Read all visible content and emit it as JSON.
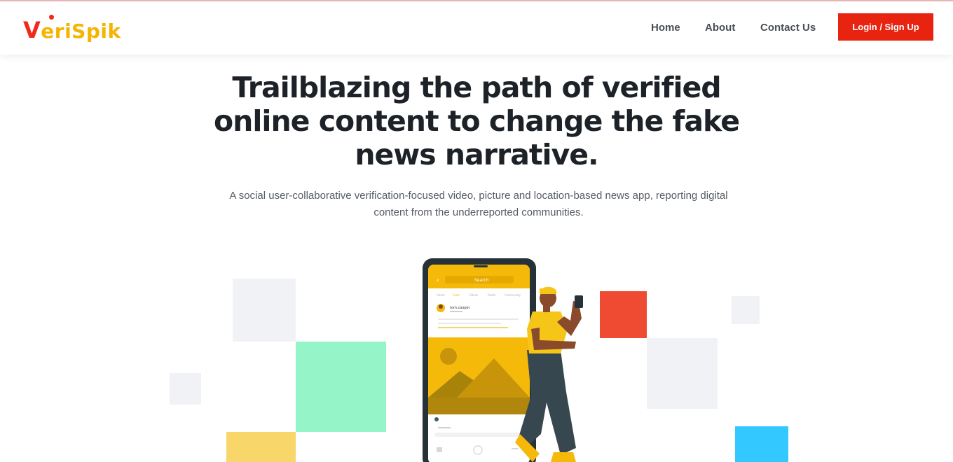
{
  "brand": {
    "logo_text": "VeriSpik"
  },
  "nav": {
    "items": [
      {
        "label": "Home"
      },
      {
        "label": "About"
      },
      {
        "label": "Contact Us"
      }
    ],
    "login_label": "Login / Sign Up"
  },
  "hero": {
    "title": "Trailblazing the path of verified online content to change the fake news narrative.",
    "subtitle": "A social user-collaborative verification-focused video, picture and location-based news app, reporting digital content from the underreported communities."
  },
  "illustration": {
    "search_placeholder": "Search",
    "username": "tom.cooper",
    "tabs": [
      "Home",
      "Feed",
      "Videos",
      "Radio",
      "Community"
    ]
  },
  "colors": {
    "accent": "#e8230f",
    "brand_yellow": "#f5b400",
    "brand_red": "#f02a1a",
    "phone_yellow": "#f5b90a",
    "square_green": "#96f5c8",
    "square_red": "#ef4b33",
    "square_blue": "#33c8ff",
    "square_yellow": "#f8d66a",
    "square_gray": "#f1f2f5"
  }
}
